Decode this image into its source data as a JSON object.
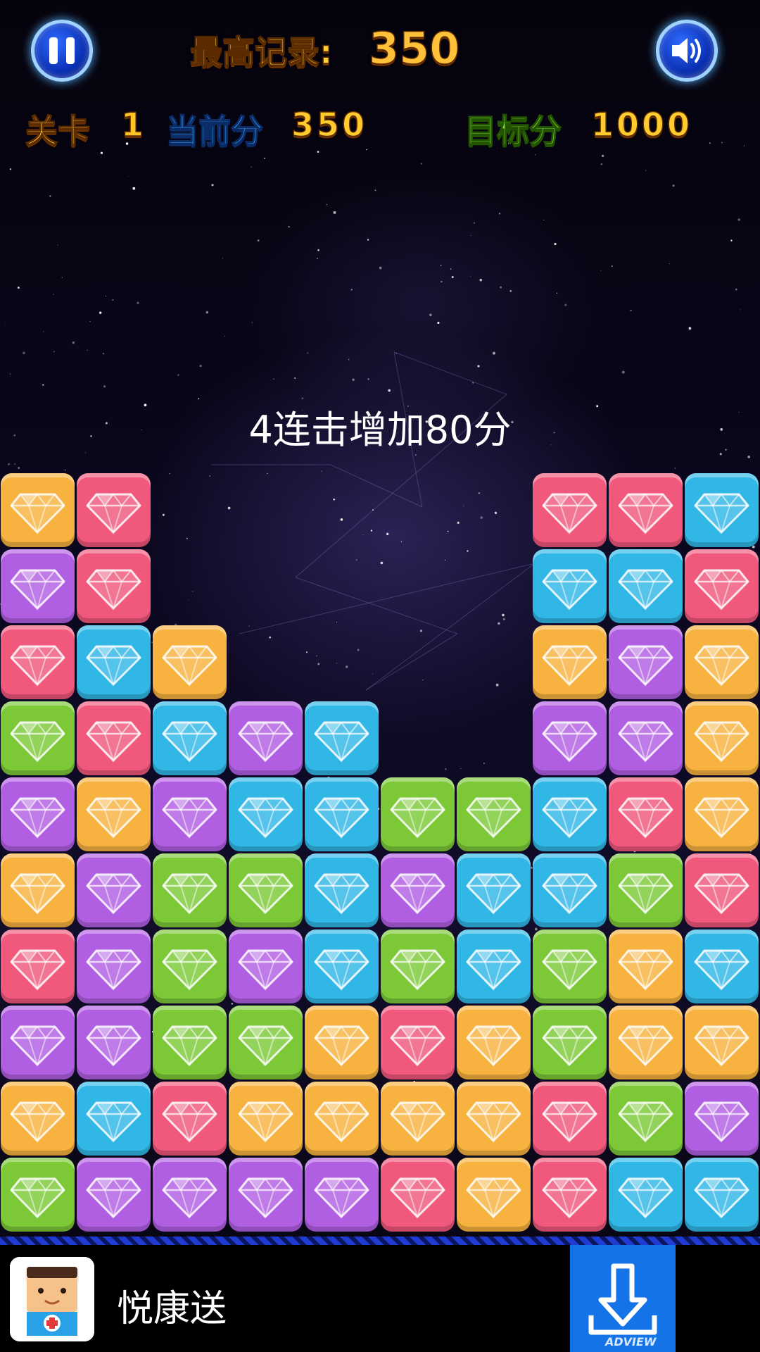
{
  "header": {
    "best_label": "最高记录:",
    "best_value": "350",
    "level_label": "关卡",
    "level_value": "1",
    "current_label": "当前分",
    "current_value": "350",
    "target_label": "目标分",
    "target_value": "1000",
    "pause_icon": "pause-icon",
    "sound_icon": "speaker-icon"
  },
  "combo_message": "4连击增加80分",
  "board": {
    "columns": 10,
    "colors": {
      "Y": "#f7b23f",
      "R": "#f0587c",
      "P": "#b15fe2",
      "C": "#31b7e6",
      "G": "#7cc837"
    },
    "grid": [
      [
        ".",
        ".",
        ".",
        ".",
        ".",
        ".",
        ".",
        ".",
        ".",
        "."
      ],
      [
        ".",
        ".",
        ".",
        ".",
        ".",
        ".",
        ".",
        ".",
        ".",
        "."
      ],
      [
        ".",
        ".",
        ".",
        ".",
        ".",
        ".",
        ".",
        ".",
        ".",
        "."
      ],
      [
        ".",
        ".",
        ".",
        ".",
        ".",
        ".",
        ".",
        ".",
        ".",
        "."
      ],
      [
        ".",
        ".",
        ".",
        ".",
        ".",
        ".",
        ".",
        ".",
        ".",
        "."
      ],
      [
        ".",
        ".",
        ".",
        ".",
        ".",
        ".",
        ".",
        ".",
        ".",
        "."
      ],
      [
        "Y",
        "R",
        ".",
        ".",
        ".",
        ".",
        ".",
        "R",
        "R",
        "C"
      ],
      [
        "P",
        "R",
        ".",
        ".",
        ".",
        ".",
        ".",
        "C",
        "C",
        "R"
      ],
      [
        "R",
        "C",
        "Y",
        ".",
        ".",
        ".",
        ".",
        "Y",
        "P",
        "Y"
      ],
      [
        "G",
        "R",
        "C",
        "P",
        "C",
        ".",
        ".",
        "P",
        "P",
        "Y"
      ],
      [
        "P",
        "Y",
        "P",
        "C",
        "C",
        "G",
        "G",
        "C",
        "R",
        "Y"
      ],
      [
        "Y",
        "P",
        "G",
        "G",
        "C",
        "P",
        "C",
        "C",
        "G",
        "R"
      ],
      [
        "R",
        "P",
        "G",
        "P",
        "C",
        "G",
        "C",
        "G",
        "Y",
        "C"
      ],
      [
        "P",
        "P",
        "G",
        "G",
        "Y",
        "R",
        "Y",
        "G",
        "Y",
        "Y"
      ],
      [
        "Y",
        "C",
        "R",
        "Y",
        "Y",
        "Y",
        "Y",
        "R",
        "G",
        "P"
      ],
      [
        "G",
        "P",
        "P",
        "P",
        "P",
        "R",
        "Y",
        "R",
        "C",
        "C"
      ]
    ]
  },
  "ad": {
    "app_name": "悦康送",
    "brand": "ADVIEW",
    "download_icon": "download-icon"
  }
}
